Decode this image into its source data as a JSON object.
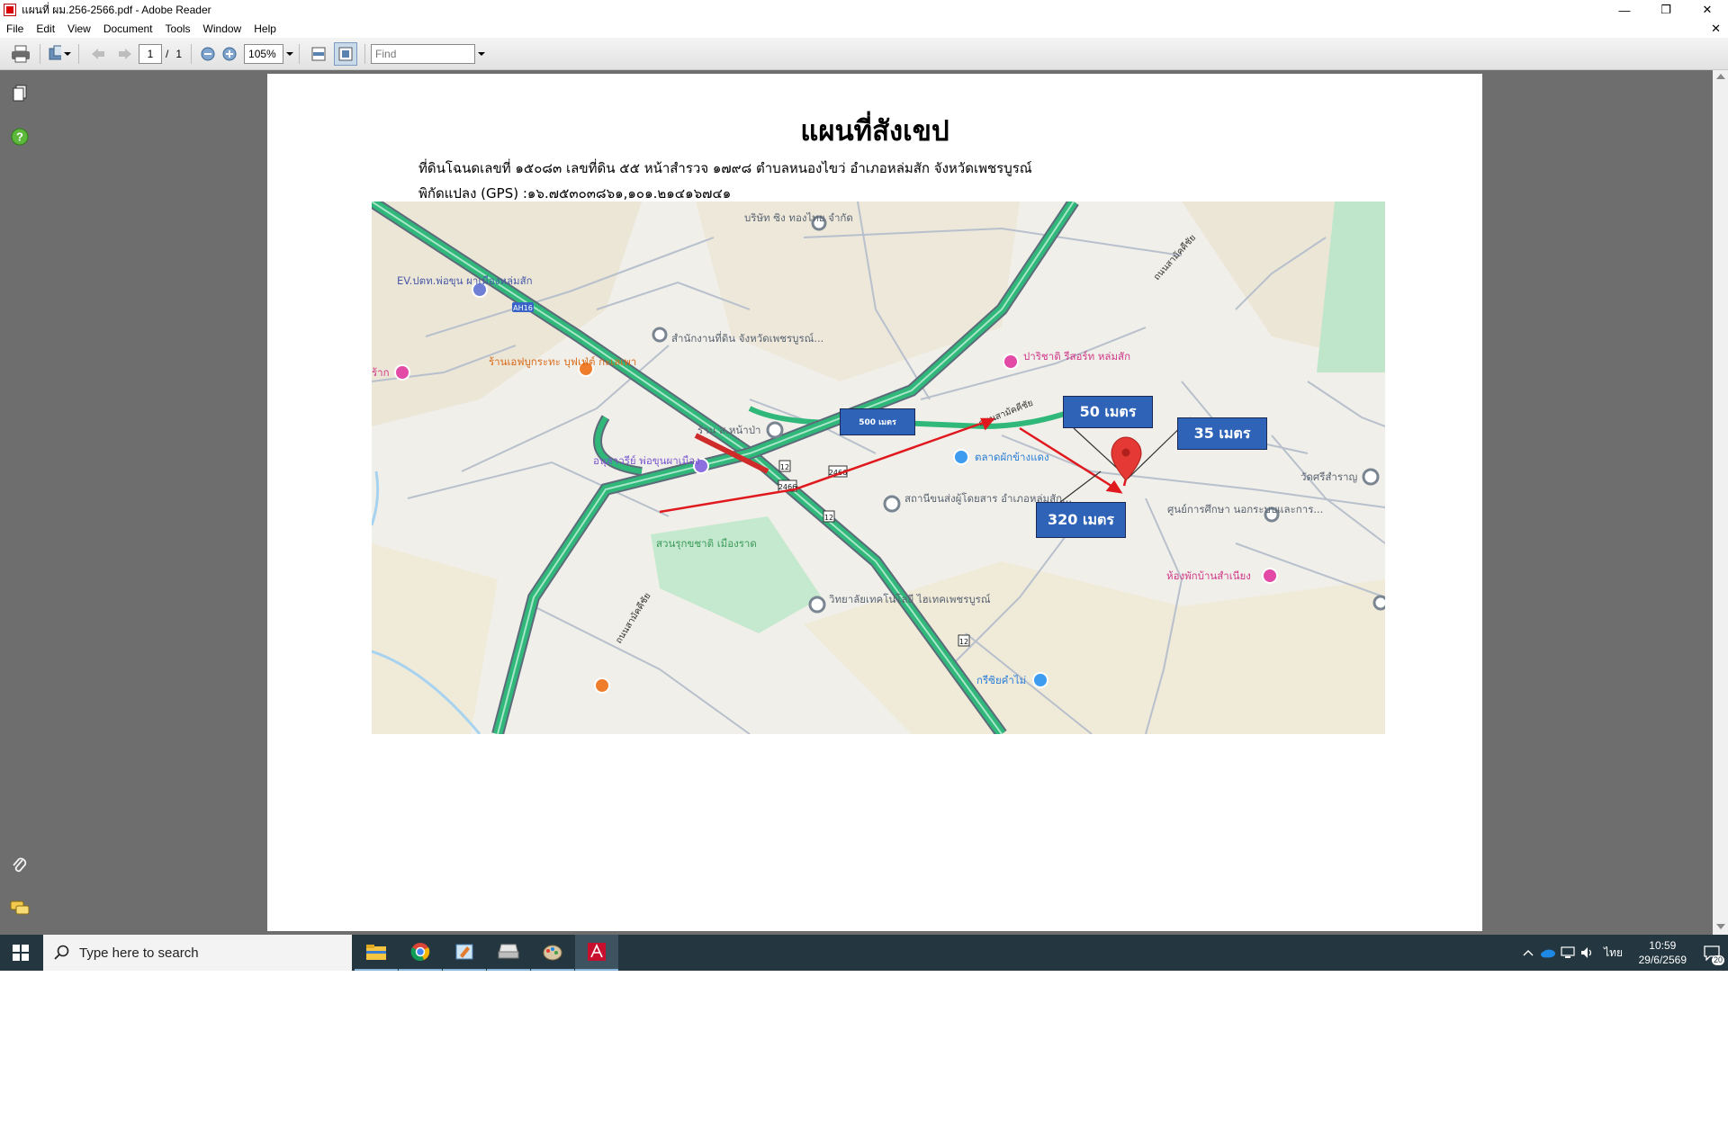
{
  "window": {
    "title": "แผนที่ ผม.256-2566.pdf - Adobe Reader",
    "minimize": "—",
    "restore": "❐",
    "close": "✕"
  },
  "menu": {
    "items": [
      "File",
      "Edit",
      "View",
      "Document",
      "Tools",
      "Window",
      "Help"
    ],
    "doc_close": "✕"
  },
  "toolbar": {
    "page_current": "1",
    "page_separator": "/",
    "page_total": "1",
    "zoom": "105%",
    "find_placeholder": "Find"
  },
  "document": {
    "title": "แผนที่สังเขป",
    "line1": "ที่ดินโฉนดเลขที่ ๑๕๐๘๓ เลขที่ดิน ๕๕ หน้าสำรวจ ๑๗๙๘ ตำบลหนองไขว่ อำเภอหล่มสัก จังหวัดเพชรบูรณ์",
    "line2": "พิกัดแปลง (GPS) :๑๖.๗๕๓๐๓๘๖๑,๑๐๑.๒๑๔๑๖๗๔๑"
  },
  "map": {
    "places": [
      "บริษัท ซิง ทองไทย จำกัด",
      "EV.ปตท.พ่อขุน ผาเมืองหล่มสัก",
      "สำนักงานที่ดิน จังหวัดเพชรบูรณ์...",
      "ร้านเอฟบูกระทะ บุฟเฟ่ต์ กะเลเพา",
      "ร้าน ส.หน้าป่า",
      "อนุสาวรีย์ พ่อขุนผาเมือง",
      "ตลาดผักข้างแดง",
      "สถานีขนส่งผู้โดยสาร อำเภอหล่มสัก...",
      "สวนรุกขชาติ เมืองราด",
      "วิทยาลัยเทคโนโลยี ไฮเทคเพชรบูรณ์",
      "ศูนย์การศึกษา นอกระบบและการ...",
      "ห้องพักบ้านสำเนียง",
      "วัดศรีสำราญ",
      "กรีซิยคำไม่",
      "ปาริชาติ รีสอร์ท หล่มสัก",
      "ร้าก"
    ],
    "roads": [
      "ถนนสามัคคีชัย",
      "ถนนสามัคคีชัย",
      "ถนนสามัคคีชัย"
    ],
    "shields": [
      "AH16",
      "2466",
      "2466",
      "12",
      "12",
      "12"
    ],
    "callouts": {
      "c500": "500 เมตร",
      "c50": "50 เมตร",
      "c35": "35 เมตร",
      "c320": "320 เมตร"
    },
    "colors": {
      "highway": "#2fb87a",
      "arrow": "#e0191f",
      "pin": "#e53935",
      "callout_bg": "#2e63b8"
    }
  },
  "taskbar": {
    "search_placeholder": "Type here to search",
    "apps": [
      "file-explorer-icon",
      "chrome-icon",
      "paint-icon",
      "printer-app-icon",
      "paint-brush-app-icon",
      "adobe-reader-icon"
    ],
    "lang": "ไทย",
    "time": "10:59",
    "date": "29/6/2569",
    "notification_count": "20"
  }
}
